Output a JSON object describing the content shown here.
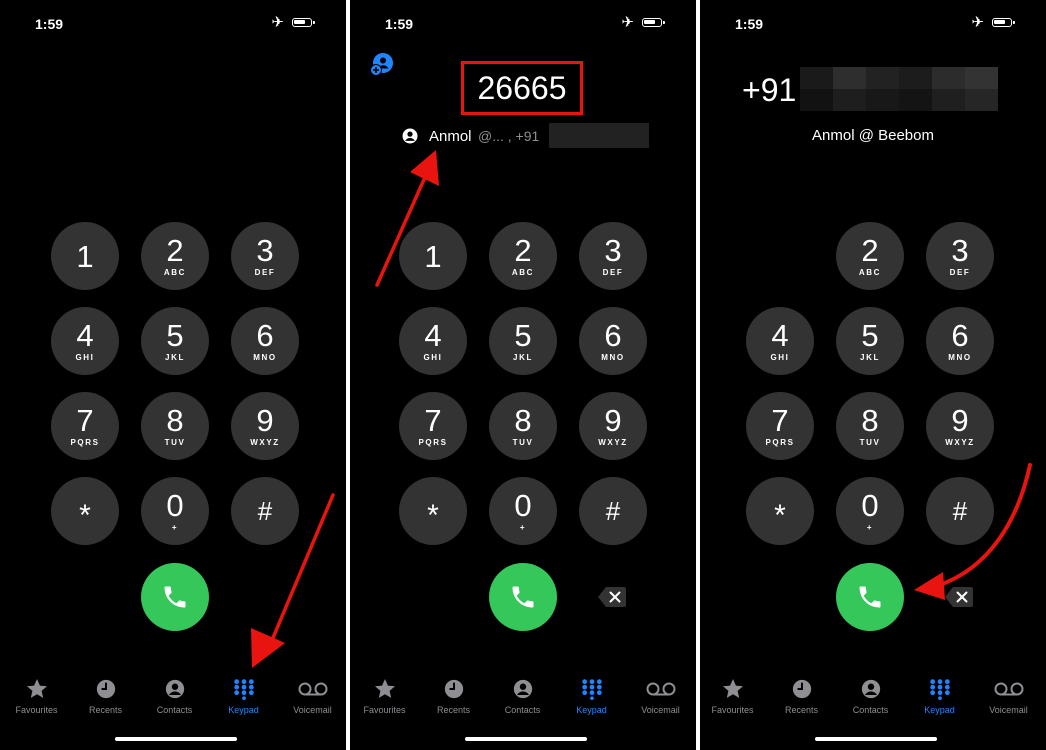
{
  "status": {
    "time": "1:59"
  },
  "keys": [
    {
      "digit": "1",
      "letters": ""
    },
    {
      "digit": "2",
      "letters": "ABC"
    },
    {
      "digit": "3",
      "letters": "DEF"
    },
    {
      "digit": "4",
      "letters": "GHI"
    },
    {
      "digit": "5",
      "letters": "JKL"
    },
    {
      "digit": "6",
      "letters": "MNO"
    },
    {
      "digit": "7",
      "letters": "PQRS"
    },
    {
      "digit": "8",
      "letters": "TUV"
    },
    {
      "digit": "9",
      "letters": "WXYZ"
    },
    {
      "digit": "*",
      "letters": ""
    },
    {
      "digit": "0",
      "letters": "+"
    },
    {
      "digit": "#",
      "letters": ""
    }
  ],
  "tabs": [
    "Favourites",
    "Recents",
    "Contacts",
    "Keypad",
    "Voicemail"
  ],
  "active_tab": "Keypad",
  "panel2": {
    "dialed_number": "26665",
    "suggestion_name": "Anmol",
    "suggestion_rest": "@... , +91"
  },
  "panel3": {
    "dialed_prefix": "+91",
    "contact_name": "Anmol @ Beebom"
  },
  "colors": {
    "background": "#000000",
    "key": "#333333",
    "call_green": "#35c759",
    "active_tab": "#1f86ff",
    "annotation_red": "#e8140f"
  },
  "icons": [
    "airplane-icon",
    "battery-icon",
    "phone-icon",
    "delete-icon",
    "star-icon",
    "clock-icon",
    "contact-icon",
    "keypad-icon",
    "voicemail-icon",
    "add-contact-icon"
  ]
}
